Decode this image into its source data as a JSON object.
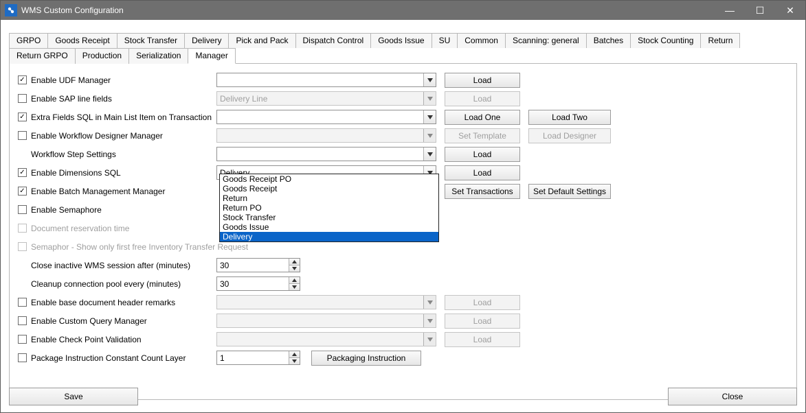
{
  "window": {
    "title": "WMS Custom Configuration"
  },
  "win_btns": {
    "min": "—",
    "max": "☐",
    "close": "✕"
  },
  "tabs": [
    "GRPO",
    "Goods Receipt",
    "Stock Transfer",
    "Delivery",
    "Pick and Pack",
    "Dispatch Control",
    "Goods Issue",
    "SU",
    "Common",
    "Scanning: general",
    "Batches",
    "Stock Counting",
    "Return",
    "Return GRPO",
    "Production",
    "Serialization",
    "Manager"
  ],
  "active_tab": "Manager",
  "rows": {
    "udf": {
      "checked": true,
      "label": "Enable UDF Manager",
      "combo": "",
      "btn1": "Load"
    },
    "sap": {
      "checked": false,
      "label": "Enable SAP line fields",
      "combo": "Delivery Line",
      "btn1": "Load",
      "combo_disabled": true,
      "btn1_disabled": true
    },
    "extra": {
      "checked": true,
      "label": "Extra Fields SQL in Main List Item on Transaction",
      "combo": "",
      "btn1": "Load One",
      "btn2": "Load Two"
    },
    "workflow": {
      "checked": false,
      "label": "Enable Workflow Designer Manager",
      "combo": "",
      "btn1": "Set Template",
      "btn2": "Load Designer",
      "combo_disabled": true,
      "btn1_disabled": true,
      "btn2_disabled": true
    },
    "wfstep": {
      "label": "Workflow Step Settings",
      "combo": "",
      "btn1": "Load"
    },
    "dim": {
      "checked": true,
      "label": "Enable Dimensions SQL",
      "combo": "Delivery",
      "btn1": "Load"
    },
    "batch": {
      "checked": true,
      "label": "Enable Batch Management Manager",
      "btn1": "Set Transactions",
      "btn2": "Set Default Settings"
    },
    "sema": {
      "checked": false,
      "label": "Enable Semaphore"
    },
    "docres": {
      "checked": false,
      "label": "Document reservation time",
      "disabled": true
    },
    "semalist": {
      "checked": false,
      "label": "Semaphor - Show only first free Inventory Transfer Request",
      "disabled": true
    },
    "closeinact": {
      "label": "Close inactive WMS session after (minutes)",
      "num": "30"
    },
    "cleanup": {
      "label": "Cleanup connection pool every (minutes)",
      "num": "30"
    },
    "basedoc": {
      "checked": false,
      "label": "Enable base document header remarks",
      "combo": "",
      "combo_disabled": true,
      "btn1": "Load",
      "btn1_disabled": true
    },
    "cquery": {
      "checked": false,
      "label": "Enable Custom Query Manager",
      "combo": "",
      "combo_disabled": true,
      "btn1": "Load",
      "btn1_disabled": true
    },
    "checkpt": {
      "checked": false,
      "label": "Enable Check Point Validation",
      "combo": "",
      "combo_disabled": true,
      "btn1": "Load",
      "btn1_disabled": true
    },
    "pkg": {
      "checked": false,
      "label": "Package Instruction Constant Count Layer",
      "num": "1",
      "btn1": "Packaging Instruction"
    }
  },
  "dropdown_open": {
    "items": [
      "Goods Receipt PO",
      "Goods Receipt",
      "Return",
      "Return PO",
      "Stock Transfer",
      "Goods Issue",
      "Delivery"
    ],
    "selected": "Delivery"
  },
  "footer": {
    "save": "Save",
    "close": "Close"
  }
}
